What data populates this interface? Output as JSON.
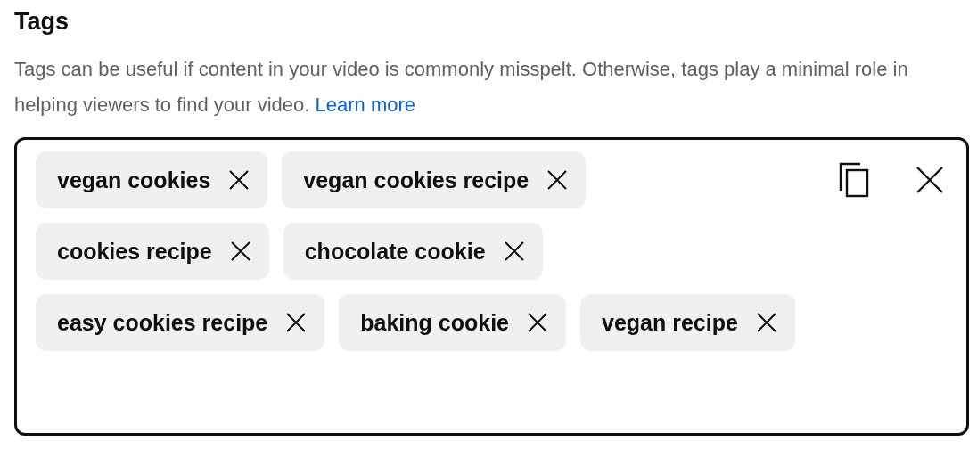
{
  "title": "Tags",
  "description": {
    "text": "Tags can be useful if content in your video is commonly misspelt. Otherwise, tags play a minimal role in helping viewers to find your video.",
    "link": "Learn more"
  },
  "tags": [
    {
      "label": "vegan cookies"
    },
    {
      "label": "vegan cookies recipe"
    },
    {
      "label": "cookies recipe"
    },
    {
      "label": "chocolate cookie"
    },
    {
      "label": "easy cookies recipe"
    },
    {
      "label": "baking cookie"
    },
    {
      "label": "vegan recipe"
    }
  ]
}
